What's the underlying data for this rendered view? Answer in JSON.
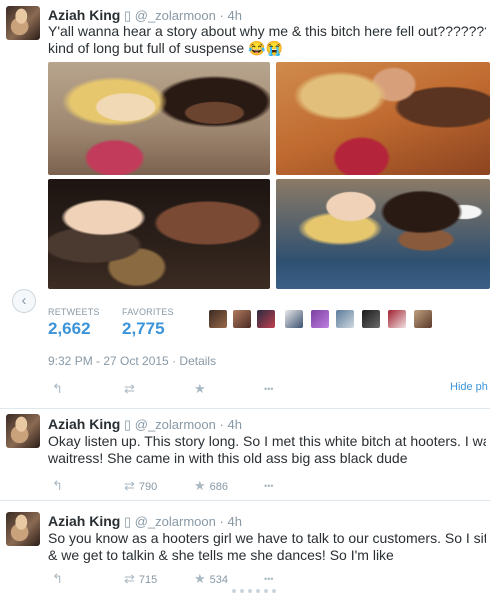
{
  "tweets": [
    {
      "name": "Aziah King",
      "verified_glyph": "▯",
      "handle": "@_zolarmoon",
      "time": "4h",
      "text_lines": [
        "Y'all wanna hear a story about why me & this bitch here fell out???????? It's",
        "kind of long but full of suspense 😂😭"
      ]
    },
    {
      "name": "Aziah King",
      "verified_glyph": "▯",
      "handle": "@_zolarmoon",
      "time": "4h",
      "text_lines": [
        "Okay listen up. This story long. So I met this white bitch at hooters. I was her",
        "waitress! She came in with this old ass big ass black dude"
      ],
      "retweets": "790",
      "favorites": "686"
    },
    {
      "name": "Aziah King",
      "verified_glyph": "▯",
      "handle": "@_zolarmoon",
      "time": "4h",
      "text_lines": [
        "So you know as a hooters girl we have to talk to our customers. So I sit wit them",
        "& we get to talkin & she tells me she dances! So I'm like"
      ],
      "retweets": "715",
      "favorites": "534"
    }
  ],
  "stats": {
    "retweets_label": "RETWEETS",
    "retweets_value": "2,662",
    "favorites_label": "FAVORITES",
    "favorites_value": "2,775"
  },
  "detail": {
    "timestamp": "9:32 PM - 27 Oct 2015",
    "separator": "·",
    "details_link": "Details"
  },
  "actions": {
    "reply_glyph": "↰",
    "retweet_glyph": "⇄",
    "favorite_glyph": "★",
    "more_glyph": "•••",
    "hide_photo": "Hide ph"
  },
  "nav": {
    "scroll_left_glyph": "‹"
  },
  "icons": [
    "reply-icon",
    "retweet-icon",
    "favorite-icon",
    "more-icon",
    "chevron-left-icon"
  ],
  "colors": {
    "accent": "#3b94d9",
    "muted": "#8899a6",
    "text": "#292f33",
    "divider": "#e1e8ed"
  }
}
